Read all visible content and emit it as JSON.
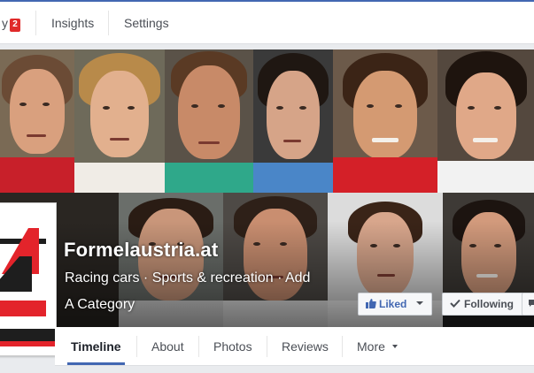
{
  "admin_bar": {
    "tabs": [
      {
        "label": "y",
        "badge": "2"
      },
      {
        "label": "Insights"
      },
      {
        "label": "Settings"
      }
    ]
  },
  "page": {
    "name": "Formelaustria.at",
    "category_line1": "Racing cars · Sports & recreation · Add",
    "category_line2": "A Category"
  },
  "actions": {
    "liked_label": "Liked",
    "following_label": "Following"
  },
  "tabs": [
    {
      "label": "Timeline",
      "active": true
    },
    {
      "label": "About"
    },
    {
      "label": "Photos"
    },
    {
      "label": "Reviews"
    },
    {
      "label": "More"
    }
  ],
  "colors": {
    "brand_blue": "#4267b2",
    "badge_red": "#e02a2a",
    "logo_red": "#e3242b"
  }
}
